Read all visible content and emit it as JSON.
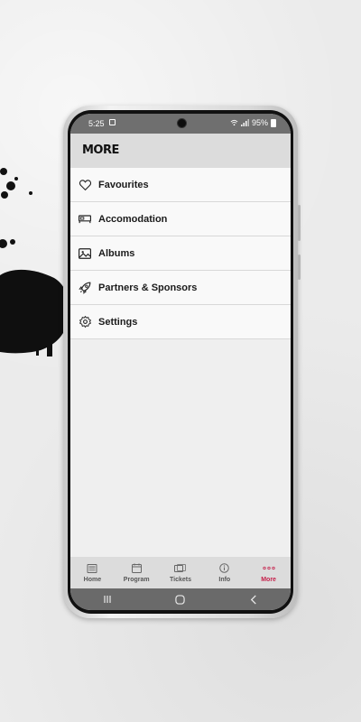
{
  "statusbar": {
    "time": "5:25",
    "battery": "95%"
  },
  "header": {
    "title": "MORE"
  },
  "menu": {
    "items": [
      {
        "label": "Favourites",
        "icon": "heart-icon"
      },
      {
        "label": "Accomodation",
        "icon": "bed-icon"
      },
      {
        "label": "Albums",
        "icon": "image-icon"
      },
      {
        "label": "Partners & Sponsors",
        "icon": "rocket-icon"
      },
      {
        "label": "Settings",
        "icon": "gear-icon"
      }
    ]
  },
  "tabbar": {
    "items": [
      {
        "label": "Home",
        "icon": "newspaper-icon"
      },
      {
        "label": "Program",
        "icon": "calendar-icon"
      },
      {
        "label": "Tickets",
        "icon": "ticket-icon"
      },
      {
        "label": "Info",
        "icon": "info-icon"
      },
      {
        "label": "More",
        "icon": "more-dots-icon",
        "active": true
      }
    ],
    "active_color": "#c51f4a"
  },
  "navbar": {
    "buttons": [
      "recent-apps-icon",
      "home-circle-icon",
      "back-chevron-icon"
    ]
  }
}
